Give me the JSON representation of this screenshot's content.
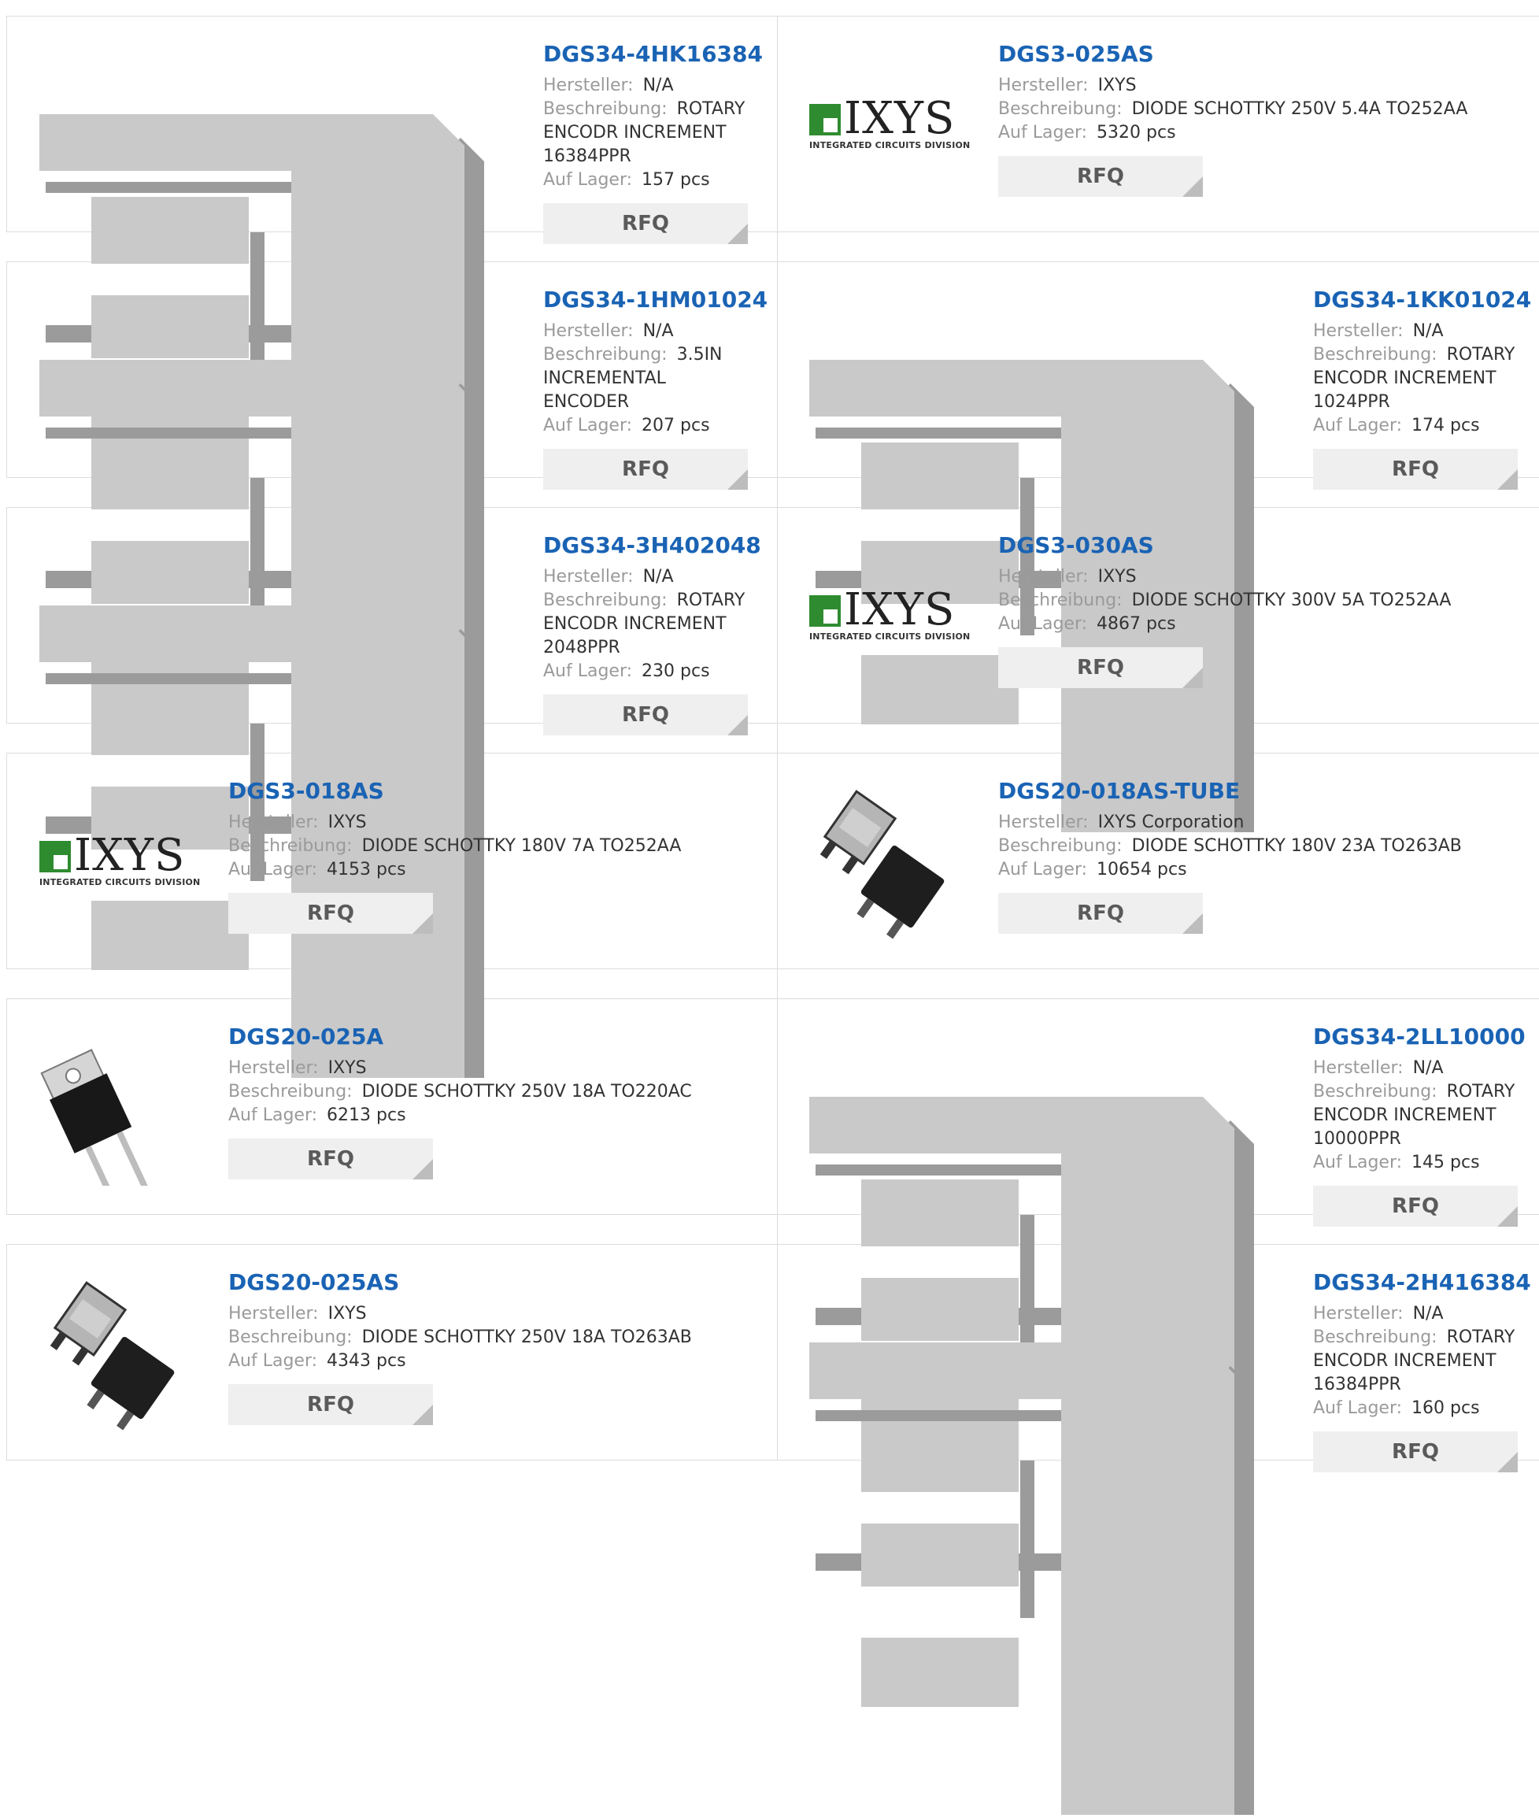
{
  "labels": {
    "manufacturer": "Hersteller:",
    "description": "Beschreibung:",
    "stock": "Auf Lager:",
    "rfq": "RFQ"
  },
  "products": [
    {
      "pn": "DGS34-4HK16384",
      "manufacturer": "N/A",
      "desc": "ROTARY ENCODR INCREMENT 16384PPR",
      "stock": "157 pcs",
      "image": "encoder-placeholder-icon"
    },
    {
      "pn": "DGS3-025AS",
      "manufacturer": "IXYS",
      "desc": "DIODE SCHOTTKY 250V 5.4A TO252AA",
      "stock": "5320 pcs",
      "image": "ixys-logo"
    },
    {
      "pn": "DGS34-1HM01024",
      "manufacturer": "N/A",
      "desc": "3.5IN INCREMENTAL ENCODER",
      "stock": "207 pcs",
      "image": "encoder-placeholder-icon"
    },
    {
      "pn": "DGS34-1KK01024",
      "manufacturer": "N/A",
      "desc": "ROTARY ENCODR INCREMENT 1024PPR",
      "stock": "174 pcs",
      "image": "encoder-placeholder-icon"
    },
    {
      "pn": "DGS34-3H402048",
      "manufacturer": "N/A",
      "desc": "ROTARY ENCODR INCREMENT 2048PPR",
      "stock": "230 pcs",
      "image": "encoder-placeholder-icon"
    },
    {
      "pn": "DGS3-030AS",
      "manufacturer": "IXYS",
      "desc": "DIODE SCHOTTKY 300V 5A TO252AA",
      "stock": "4867 pcs",
      "image": "ixys-logo"
    },
    {
      "pn": "DGS3-018AS",
      "manufacturer": "IXYS",
      "desc": "DIODE SCHOTTKY 180V 7A TO252AA",
      "stock": "4153 pcs",
      "image": "ixys-logo"
    },
    {
      "pn": "DGS20-018AS-TUBE",
      "manufacturer": "IXYS Corporation",
      "desc": "DIODE SCHOTTKY 180V 23A TO263AB",
      "stock": "10654 pcs",
      "image": "to263-package-icon"
    },
    {
      "pn": "DGS20-025A",
      "manufacturer": "IXYS",
      "desc": "DIODE SCHOTTKY 250V 18A TO220AC",
      "stock": "6213 pcs",
      "image": "to220-package-icon"
    },
    {
      "pn": "DGS34-2LL10000",
      "manufacturer": "N/A",
      "desc": "ROTARY ENCODR INCREMENT 10000PPR",
      "stock": "145 pcs",
      "image": "encoder-placeholder-icon"
    },
    {
      "pn": "DGS20-025AS",
      "manufacturer": "IXYS",
      "desc": "DIODE SCHOTTKY 250V 18A TO263AB",
      "stock": "4343 pcs",
      "image": "to263-package-icon"
    },
    {
      "pn": "DGS34-2H416384",
      "manufacturer": "N/A",
      "desc": "ROTARY ENCODR INCREMENT 16384PPR",
      "stock": "160 pcs",
      "image": "encoder-placeholder-icon"
    }
  ],
  "logo": {
    "ixys_text": "IXYS",
    "ixys_subtitle": "INTEGRATED CIRCUITS DIVISION"
  }
}
